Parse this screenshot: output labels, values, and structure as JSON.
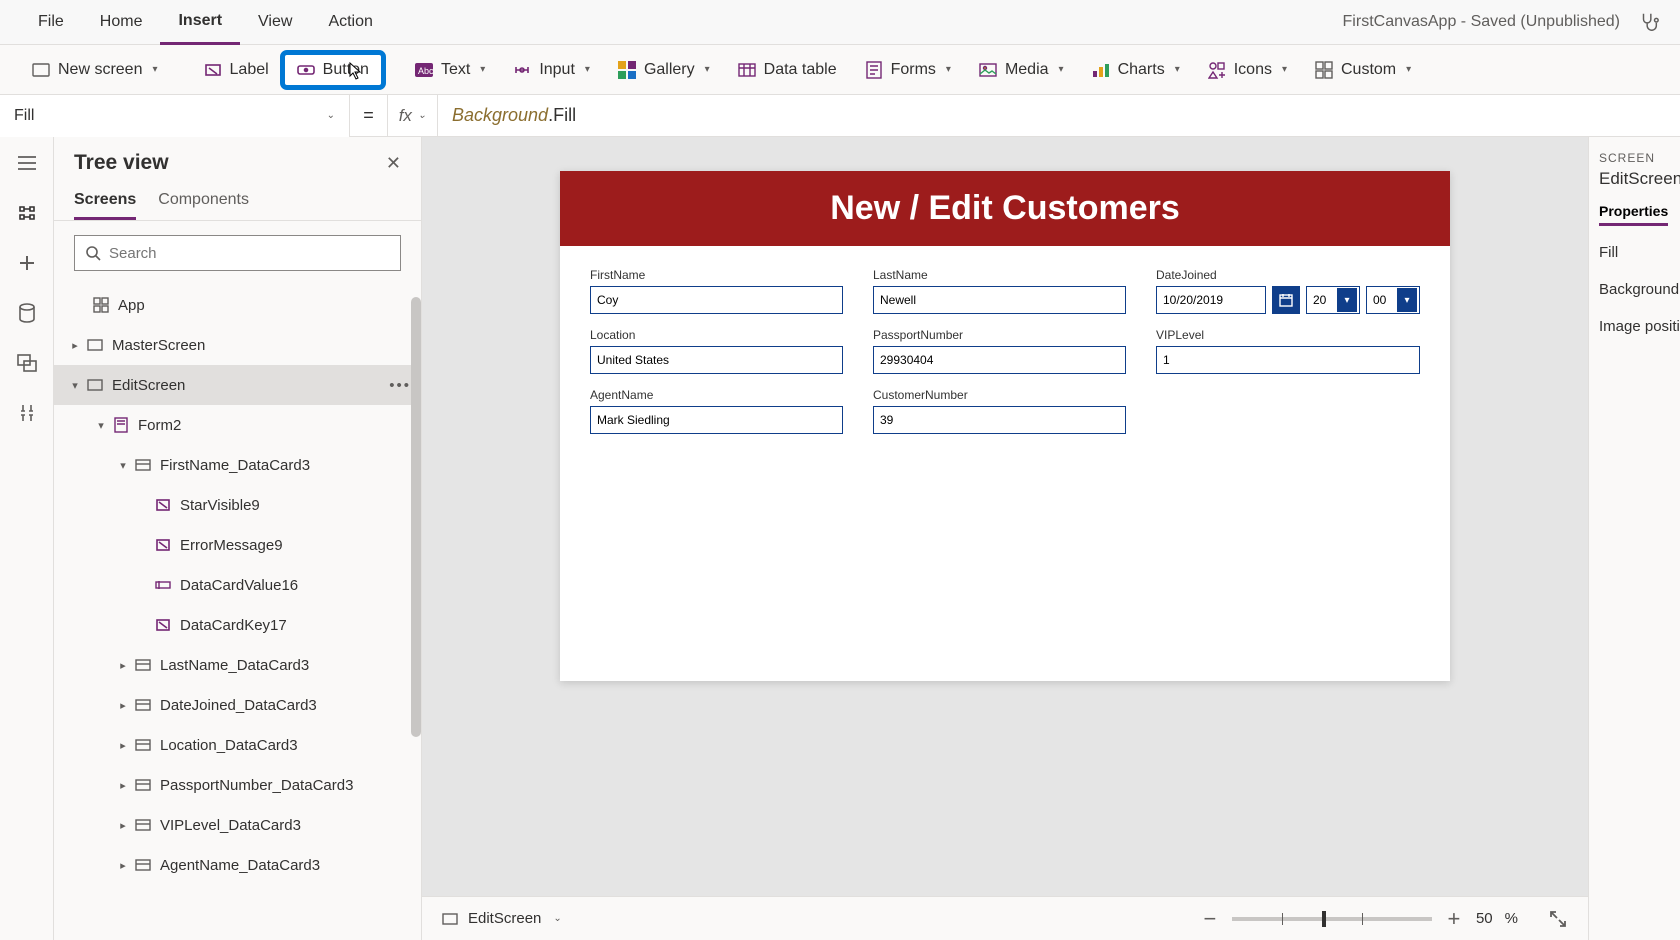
{
  "menu": {
    "items": [
      "File",
      "Home",
      "Insert",
      "View",
      "Action"
    ],
    "active": "Insert"
  },
  "appTitle": "FirstCanvasApp - Saved (Unpublished)",
  "ribbon": {
    "newScreen": "New screen",
    "label": "Label",
    "button": "Button",
    "text": "Text",
    "input": "Input",
    "gallery": "Gallery",
    "dataTable": "Data table",
    "forms": "Forms",
    "media": "Media",
    "charts": "Charts",
    "icons": "Icons",
    "custom": "Custom"
  },
  "formulaBar": {
    "property": "Fill",
    "eq": "=",
    "fx": "fx",
    "expr1": "Background",
    "expr2": ".Fill"
  },
  "tree": {
    "title": "Tree view",
    "tabs": {
      "screens": "Screens",
      "components": "Components"
    },
    "searchPlaceholder": "Search",
    "app": "App",
    "master": "MasterScreen",
    "edit": "EditScreen",
    "form2": "Form2",
    "fn_dc": "FirstName_DataCard3",
    "star9": "StarVisible9",
    "err9": "ErrorMessage9",
    "val16": "DataCardValue16",
    "key17": "DataCardKey17",
    "ln_dc": "LastName_DataCard3",
    "dj_dc": "DateJoined_DataCard3",
    "loc_dc": "Location_DataCard3",
    "pp_dc": "PassportNumber_DataCard3",
    "vip_dc": "VIPLevel_DataCard3",
    "ag_dc": "AgentName_DataCard3"
  },
  "screen": {
    "banner": "New / Edit Customers",
    "fields": {
      "firstName": {
        "label": "FirstName",
        "value": "Coy"
      },
      "lastName": {
        "label": "LastName",
        "value": "Newell"
      },
      "dateJoined": {
        "label": "DateJoined",
        "value": "10/20/2019",
        "hour": "20",
        "minute": "00"
      },
      "location": {
        "label": "Location",
        "value": "United States"
      },
      "passport": {
        "label": "PassportNumber",
        "value": "29930404"
      },
      "vip": {
        "label": "VIPLevel",
        "value": "1"
      },
      "agent": {
        "label": "AgentName",
        "value": "Mark Siedling"
      },
      "custNum": {
        "label": "CustomerNumber",
        "value": "39"
      }
    }
  },
  "statusbar": {
    "screenName": "EditScreen",
    "zoom": "50",
    "zoomUnit": "%"
  },
  "props": {
    "context": "SCREEN",
    "name": "EditScreen",
    "tab": "Properties",
    "rows": [
      "Fill",
      "Background",
      "Image positi"
    ]
  }
}
